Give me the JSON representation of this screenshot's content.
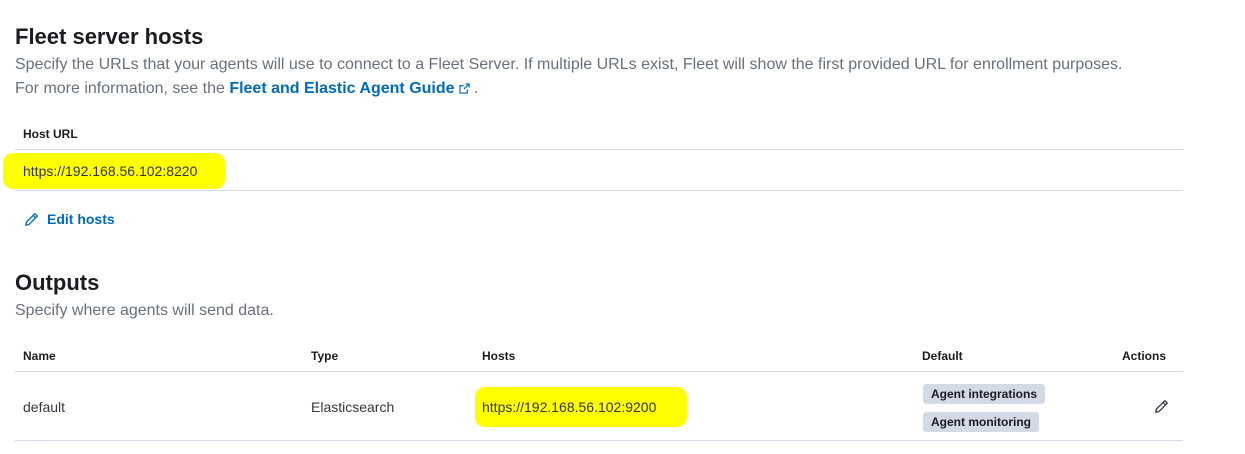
{
  "fleet_section": {
    "title": "Fleet server hosts",
    "description_start": "Specify the URLs that your agents will use to connect to a Fleet Server. If multiple URLs exist, Fleet will show the first provided URL for enrollment purposes. For more information, see the ",
    "guide_link": "Fleet and Elastic Agent Guide",
    "description_end": " .",
    "table_header": "Host URL",
    "host_url": "https://192.168.56.102:8220",
    "edit_label": "Edit hosts",
    "link_color": "#006bb8"
  },
  "outputs_section": {
    "title": "Outputs",
    "description": "Specify where agents will send data.",
    "columns": {
      "name": "Name",
      "type": "Type",
      "hosts": "Hosts",
      "default": "Default",
      "actions": "Actions"
    },
    "rows": [
      {
        "name": "default",
        "type": "Elasticsearch",
        "hosts": "https://192.168.56.102:9200",
        "badges": [
          "Agent integrations",
          "Agent monitoring"
        ]
      }
    ]
  },
  "highlight_color": "#ffff00",
  "icons": [
    "external-link-icon",
    "pencil-icon"
  ]
}
